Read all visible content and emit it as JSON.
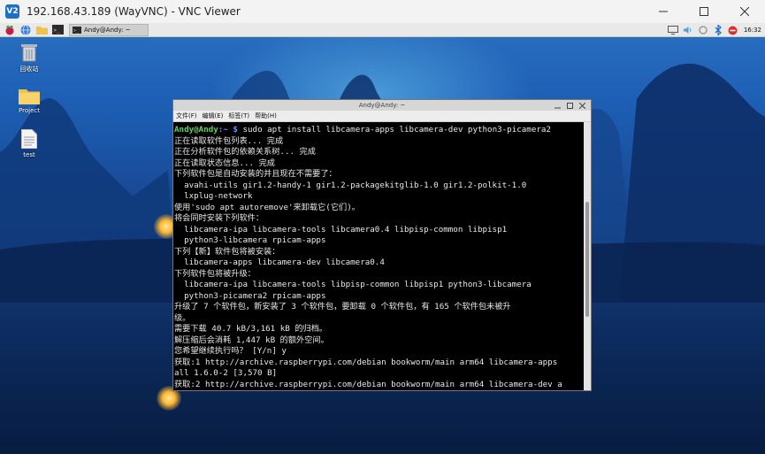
{
  "window": {
    "app_icon_text": "V2",
    "title": "192.168.43.189 (WayVNC) - VNC Viewer",
    "icons": [
      "minimize-icon",
      "maximize-icon",
      "close-icon"
    ]
  },
  "panel": {
    "icons": [
      "raspberry-menu-icon",
      "browser-icon",
      "file-manager-icon",
      "terminal-icon"
    ],
    "task_label": "Andy@Andy: ~",
    "tray_icons": [
      "display-icon",
      "volume-icon",
      "network-icon",
      "bluetooth-icon",
      "stop-icon"
    ],
    "clock": "16:32"
  },
  "desktop_icons": [
    {
      "label": "回收站",
      "icon": "trash-icon"
    },
    {
      "label": "Project",
      "icon": "folder-icon"
    },
    {
      "label": "test",
      "icon": "file-icon"
    }
  ],
  "terminal": {
    "title": "Andy@Andy: ~",
    "menu": [
      "文件(F)",
      "编辑(E)",
      "标签(T)",
      "帮助(H)"
    ],
    "prompt_user": "Andy@Andy",
    "prompt_path": ":~ $",
    "command": " sudo apt install libcamera-apps libcamera-dev python3-picamera2",
    "output": [
      "正在读取软件包列表... 完成",
      "正在分析软件包的依赖关系树... 完成",
      "正在读取状态信息... 完成",
      "下列软件包是自动安装的并且现在不需要了：",
      "  avahi-utils gir1.2-handy-1 gir1.2-packagekitglib-1.0 gir1.2-polkit-1.0",
      "  lxplug-network",
      "使用'sudo apt autoremove'来卸载它(它们)。",
      "将会同时安装下列软件：",
      "  libcamera-ipa libcamera-tools libcamera0.4 libpisp-common libpisp1",
      "  python3-libcamera rpicam-apps",
      "下列【新】软件包将被安装：",
      "  libcamera-apps libcamera-dev libcamera0.4",
      "下列软件包将被升级：",
      "  libcamera-ipa libcamera-tools libpisp-common libpisp1 python3-libcamera",
      "  python3-picamera2 rpicam-apps",
      "升级了 7 个软件包，新安装了 3 个软件包，要卸载 0 个软件包，有 165 个软件包未被升",
      "级。",
      "需要下载 40.7 kB/3,161 kB 的归档。",
      "解压缩后会消耗 1,447 kB 的额外空间。",
      "您希望继续执行吗？ [Y/n] y",
      "获取:1 http://archive.raspberrypi.com/debian bookworm/main arm64 libcamera-apps",
      "all 1.6.0-2 [3,570 B]",
      "获取:2 http://archive.raspberrypi.com/debian bookworm/main arm64 libcamera-dev a"
    ]
  }
}
